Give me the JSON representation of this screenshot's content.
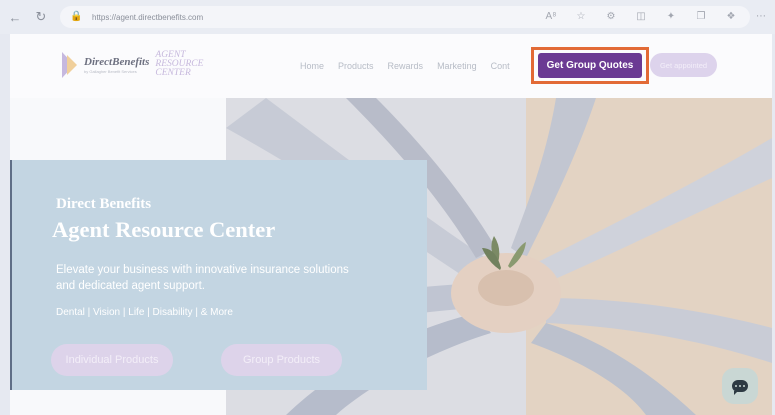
{
  "browser": {
    "url": "https://agent.directbenefits.com",
    "icons": [
      "back-icon",
      "reload-icon",
      "lock-icon",
      "read-aloud-icon",
      "favorite-icon",
      "extensions-icon",
      "split-screen-icon",
      "favorites-bar-icon",
      "collections-icon",
      "copilot-icon",
      "more-icon"
    ]
  },
  "header": {
    "brand": "DirectBenefits",
    "brand_tag": "by Gallagher Benefit Services",
    "arc_line1": "AGENT",
    "arc_line2": "RESOURCE",
    "arc_line3": "CENTER",
    "nav": [
      "Home",
      "Products",
      "Rewards",
      "Marketing",
      "Cont"
    ],
    "cta_label": "Get Group Quotes",
    "appoint_label": "Get appointed"
  },
  "hero": {
    "eyebrow": "Direct Benefits",
    "title": "Agent Resource Center",
    "description": "Elevate your business with innovative insurance solutions and dedicated agent support.",
    "lines": "Dental | Vision | Life | Disability | & More",
    "btn_individual": "Individual Products",
    "btn_group": "Group Products"
  },
  "colors": {
    "cta": "#6b3a93",
    "highlight": "#e26a36",
    "card": "#c3d5e2"
  }
}
